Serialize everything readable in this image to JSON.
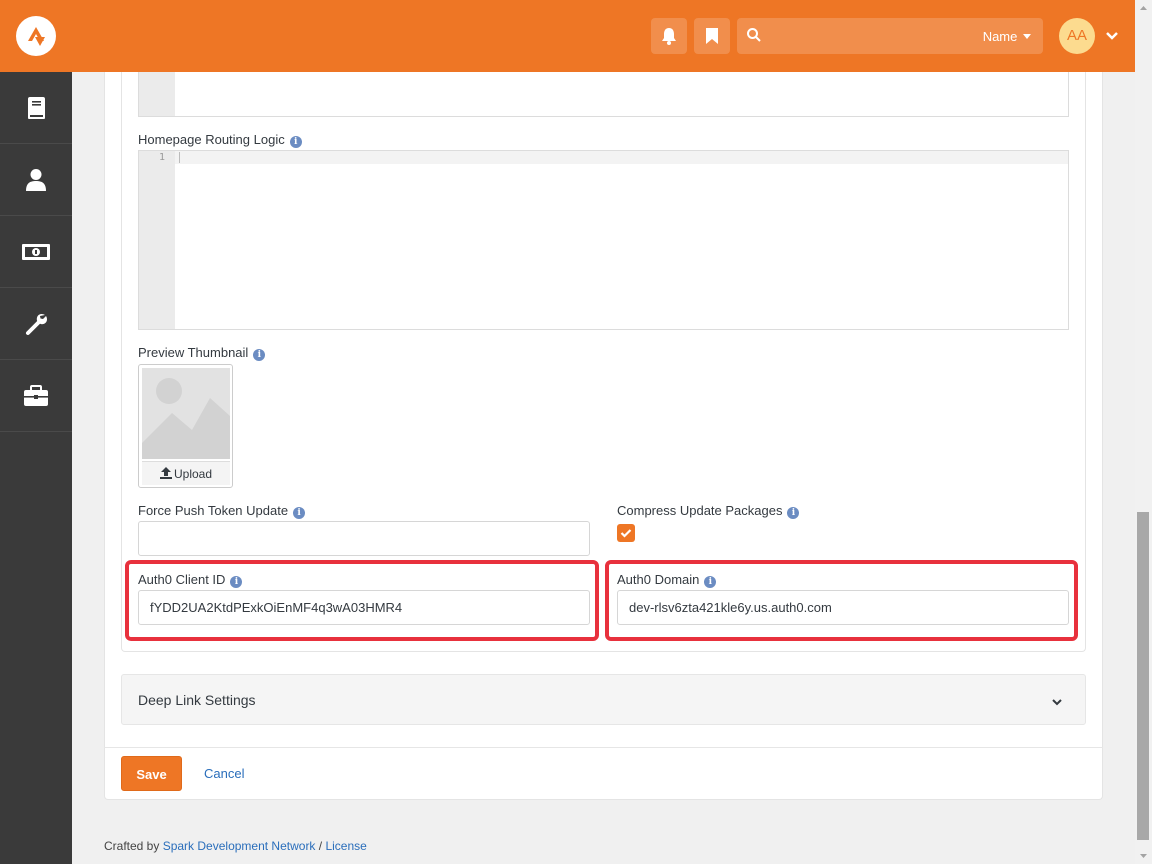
{
  "header": {
    "search_filter_label": "Name",
    "avatar_initials": "AA"
  },
  "sidebar": {
    "items": [
      {
        "icon": "book-icon"
      },
      {
        "icon": "person-icon"
      },
      {
        "icon": "money-icon"
      },
      {
        "icon": "wrench-icon"
      },
      {
        "icon": "briefcase-icon"
      }
    ]
  },
  "form": {
    "homepage_routing_label": "Homepage Routing Logic",
    "line_number": "1",
    "preview_thumbnail_label": "Preview Thumbnail",
    "upload_label": "Upload",
    "force_push_label": "Force Push Token Update",
    "force_push_value": "",
    "compress_label": "Compress Update Packages",
    "compress_checked": true,
    "auth0_client_id_label": "Auth0 Client ID",
    "auth0_client_id_value": "fYDD2UA2KtdPExkOiEnMF4q3wA03HMR4",
    "auth0_domain_label": "Auth0 Domain",
    "auth0_domain_value": "dev-rlsv6zta421kle6y.us.auth0.com"
  },
  "deep_link": {
    "title": "Deep Link Settings"
  },
  "actions": {
    "save_label": "Save",
    "cancel_label": "Cancel"
  },
  "footer": {
    "crafted_by": "Crafted by",
    "org_link": "Spark Development Network",
    "separator": "/",
    "license_link": "License"
  },
  "colors": {
    "brand": "#ee7625",
    "sidebar": "#3a3a3a",
    "highlight": "#e8313d",
    "link": "#2a6ebb"
  }
}
